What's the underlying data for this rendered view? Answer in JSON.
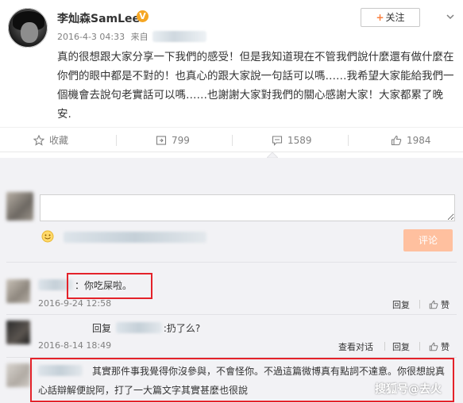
{
  "post": {
    "username": "李灿森SamLee",
    "badge": "V",
    "timestamp": "2016-4-3 04:33",
    "source_prefix": "来自",
    "follow_label": "关注",
    "text": "真的很想跟大家分享一下我們的感受！但是我知道現在不管我們說什麼還有做什麼在你們的眼中都是不對的！也真心的跟大家說一句話可以嗎……我希望大家能給我們一個機會去說句老實話可以嗎……也謝謝大家對我們的關心感謝大家！大家都累了晚安."
  },
  "actions": {
    "favorite": "收藏",
    "repost": "799",
    "comment": "1589",
    "like": "1984"
  },
  "compose": {
    "placeholder": "",
    "submit_label": "评论"
  },
  "comments": [
    {
      "text_prefix": "：",
      "text": "你吃屎啦。",
      "time": "2016-9-24 12:58",
      "reply_label": "回复",
      "like_label": "赞"
    },
    {
      "reply_word": "回复",
      "text": ":扔了么?",
      "time": "2016-8-14 18:49",
      "view_thread_label": "查看对话",
      "reply_label": "回复",
      "like_label": "赞"
    },
    {
      "text_line1": "其實那件事我覺得你沒參與，不會怪你。不過這篇微博真有點詞不達意。你很想說真",
      "text_line2": "心話辯解便說阿，打了一大篇文字其實甚麼也很說",
      "time": "2016-8-14"
    }
  ],
  "watermark": "搜狐号@去火",
  "colors": {
    "highlight_box": "#e4222a",
    "submit_button": "#ffc09f",
    "follow_plus": "#fa7d3c",
    "badge": "#f5a623"
  }
}
